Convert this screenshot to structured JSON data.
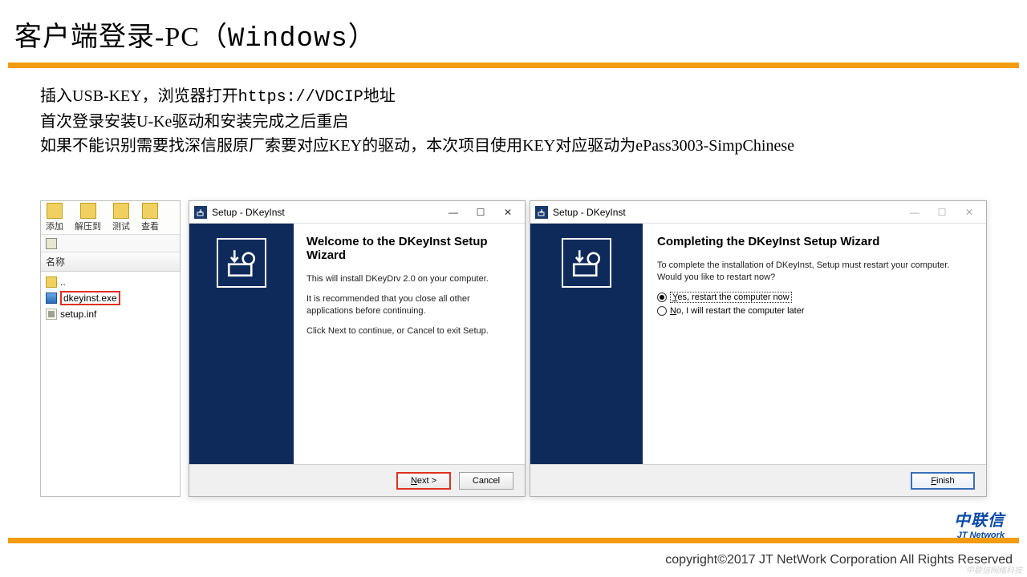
{
  "title_cn": "客户端登录-PC（",
  "title_win": "Windows",
  "title_end": "）",
  "body": {
    "line1a": "插入USB-KEY，浏览器打开",
    "line1b": "https://VDCIP",
    "line1c": "地址",
    "line2": "首次登录安装U-Ke驱动和安装完成之后重启",
    "line3": "如果不能识别需要找深信服原厂索要对应KEY的驱动，本次项目使用KEY对应驱动为ePass3003-SimpChinese"
  },
  "explorer": {
    "tb_add": "添加",
    "tb_extract": "解压到",
    "tb_test": "测试",
    "tb_view": "查看",
    "hdr_name": "名称",
    "item_up": "..",
    "item_exe": "dkeyinst.exe",
    "item_inf": "setup.inf"
  },
  "setup1": {
    "titlebar": "Setup - DKeyInst",
    "heading": "Welcome to the DKeyInst Setup Wizard",
    "p1": "This will install DKeyDrv 2.0 on your computer.",
    "p2": "It is recommended that you close all other applications before continuing.",
    "p3": "Click Next to continue, or Cancel to exit Setup.",
    "btn_next": "Next >",
    "btn_cancel": "Cancel"
  },
  "setup2": {
    "titlebar": "Setup - DKeyInst",
    "heading": "Completing the DKeyInst Setup Wizard",
    "p1": "To complete the installation of DKeyInst, Setup must restart your computer. Would you like to restart now?",
    "opt_yes": "Yes, restart the computer now",
    "opt_no": "No, I will restart the computer later",
    "btn_finish": "Finish"
  },
  "footer": {
    "logo_cn": "中联信",
    "logo_en": "JT Network",
    "copyright": "copyright©2017  JT NetWork Corporation All Rights Reserved",
    "watermark": "中联信网络科技"
  },
  "win": {
    "min": "—",
    "max": "☐",
    "close": "✕"
  }
}
